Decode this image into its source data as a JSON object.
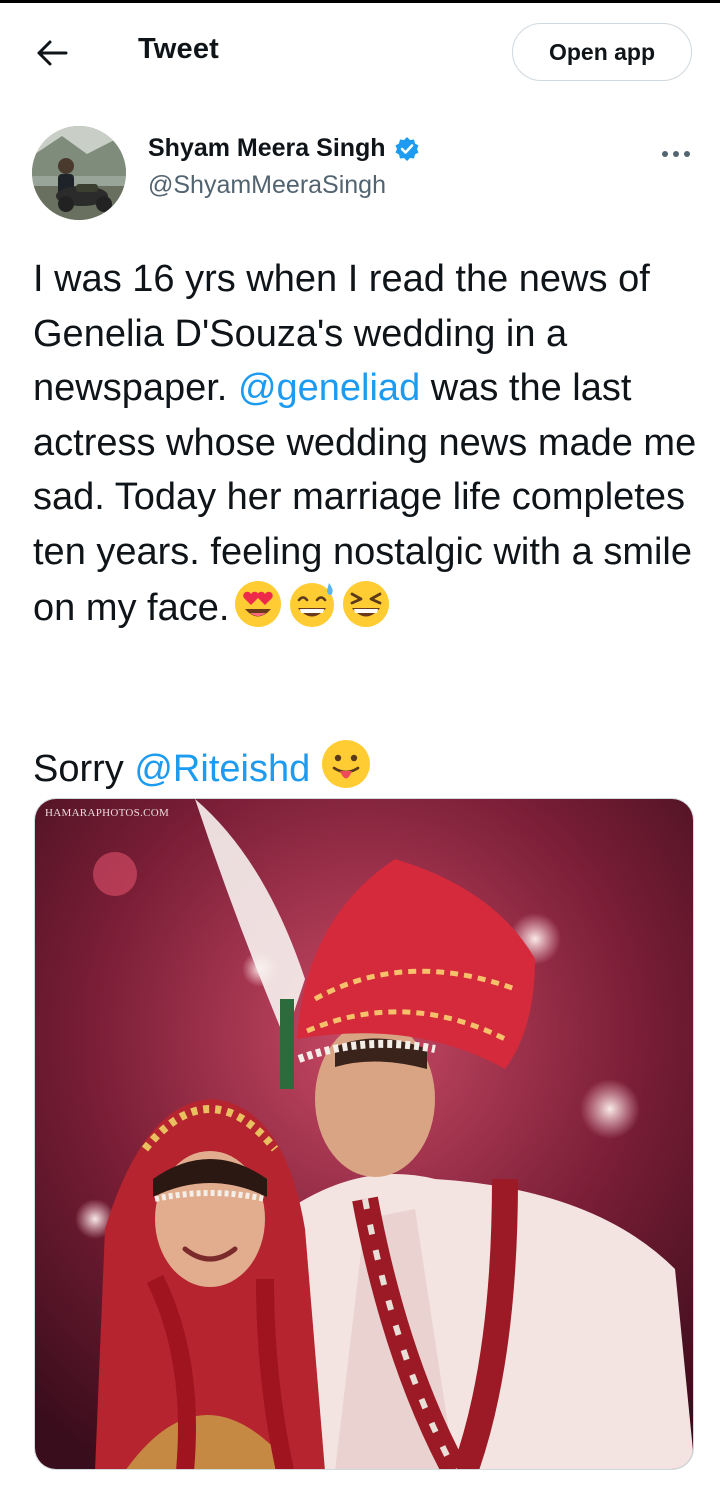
{
  "header": {
    "title": "Tweet",
    "open_app_label": "Open app"
  },
  "author": {
    "display_name": "Shyam Meera Singh",
    "handle": "@ShyamMeeraSingh",
    "verified": true
  },
  "tweet": {
    "line1": "I was 16 yrs when I read the news of Genelia D'Souza's wedding in a newspaper.",
    "mention1": "@geneliad",
    "line2": "was the last actress whose wedding news made me sad. Today her marriage life completes ten years. feeling nostalgic with a smile on my face.",
    "emojis_1": [
      "heart-eyes-emoji",
      "grinning-sweat-emoji",
      "laughing-squinting-emoji"
    ],
    "sorry": "Sorry",
    "mention2": "@Riteishd",
    "emoji_2": "tongue-out-emoji"
  },
  "media": {
    "watermark": "HAMARAPHOTOS.COM"
  },
  "colors": {
    "link": "#1d9bf0",
    "text": "#0f1419",
    "secondary": "#536471",
    "border": "#cfd9de"
  }
}
